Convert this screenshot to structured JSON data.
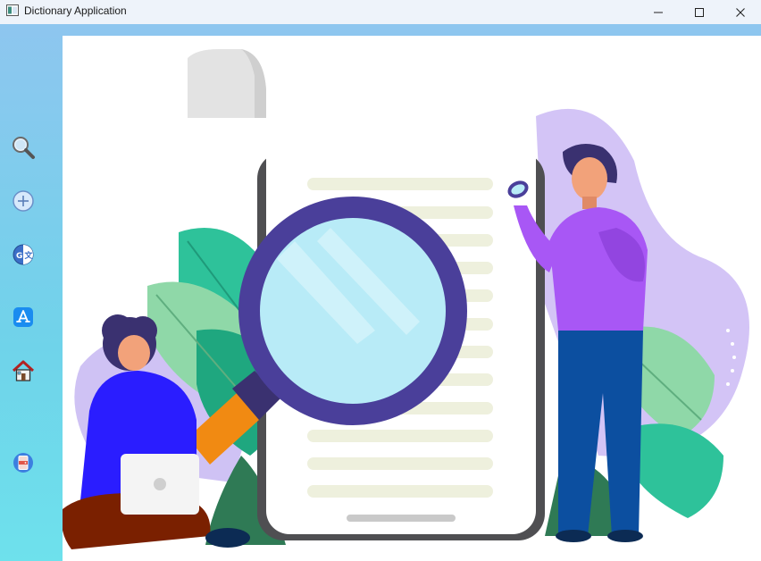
{
  "window": {
    "title": "Dictionary Application",
    "controls": [
      "minimize",
      "maximize",
      "close"
    ]
  },
  "sidebar": {
    "items": [
      {
        "name": "search",
        "icon": "magnifier-icon"
      },
      {
        "name": "add",
        "icon": "plus-circle-icon"
      },
      {
        "name": "translate",
        "icon": "translate-globe-icon"
      },
      {
        "name": "app-store",
        "icon": "app-store-icon"
      },
      {
        "name": "home",
        "icon": "house-icon"
      },
      {
        "name": "exit",
        "icon": "exit-door-icon"
      }
    ]
  },
  "colors": {
    "sidebar_gradient_top": "#8ec6ef",
    "sidebar_gradient_bottom": "#6ee1ec",
    "titlebar": "#eef3fa",
    "accent_purple": "#4a3f9a"
  },
  "illustration": {
    "subject": "people-searching-document-illustration"
  }
}
